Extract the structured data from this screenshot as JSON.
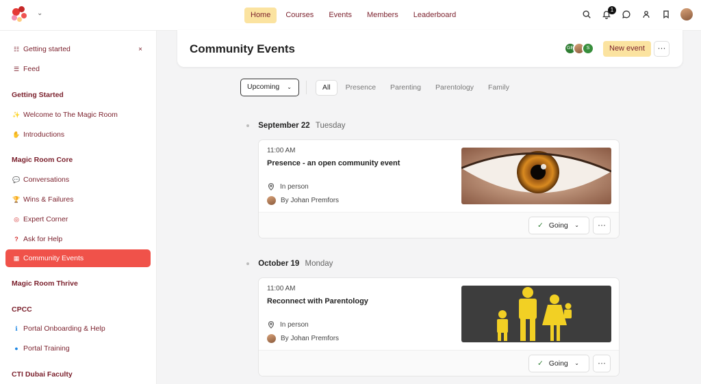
{
  "topnav": {
    "items": [
      {
        "label": "Home",
        "active": true
      },
      {
        "label": "Courses",
        "active": false
      },
      {
        "label": "Events",
        "active": false
      },
      {
        "label": "Members",
        "active": false
      },
      {
        "label": "Leaderboard",
        "active": false
      }
    ],
    "notification_count": "1"
  },
  "sidebar": {
    "getting_started_top": "Getting started",
    "close_glyph": "×",
    "feed": "Feed",
    "sections": {
      "getting_started": "Getting Started",
      "core": "Magic Room Core",
      "thrive": "Magic Room Thrive",
      "cpcc": "CPCC",
      "cti": "CTI Dubai Faculty"
    },
    "items": {
      "welcome": "Welcome to The Magic Room",
      "introductions": "Introductions",
      "conversations": "Conversations",
      "wins": "Wins & Failures",
      "expert": "Expert Corner",
      "help": "Ask for Help",
      "community_events": "Community Events",
      "portal_onboarding": "Portal Onboarding & Help",
      "portal_training": "Portal Training"
    }
  },
  "header": {
    "title": "Community Events",
    "new_event_label": "New event",
    "more_glyph": "···",
    "avatar_initials": [
      "GE",
      "",
      "S"
    ]
  },
  "filters": {
    "dropdown_label": "Upcoming",
    "tabs": [
      "All",
      "Presence",
      "Parenting",
      "Parentology",
      "Family"
    ]
  },
  "events": [
    {
      "date": "September 22",
      "weekday": "Tuesday",
      "time": "11:00 AM",
      "title": "Presence - an open community event",
      "location": "In person",
      "host": "By Johan Premfors",
      "rsvp": "Going"
    },
    {
      "date": "October 19",
      "weekday": "Monday",
      "time": "11:00 AM",
      "title": "Reconnect with Parentology",
      "location": "In person",
      "host": "By Johan Premfors",
      "rsvp": "Going"
    }
  ],
  "colors": {
    "accent_active": "#f0524a",
    "nav_highlight": "#fbe3a0",
    "link_text": "#7a1f2b"
  }
}
